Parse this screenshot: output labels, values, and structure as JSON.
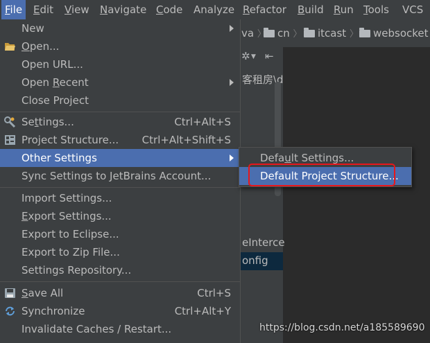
{
  "menubar": {
    "items": [
      {
        "mnemonic": "F",
        "rest": "ile"
      },
      {
        "mnemonic": "E",
        "rest": "dit"
      },
      {
        "mnemonic": "V",
        "rest": "iew"
      },
      {
        "mnemonic": "N",
        "rest": "avigate"
      },
      {
        "mnemonic": "C",
        "rest": "ode"
      },
      {
        "mnemonic": "",
        "rest": "Analyze"
      },
      {
        "mnemonic": "R",
        "rest": "efactor"
      },
      {
        "mnemonic": "B",
        "rest": "uild"
      },
      {
        "mnemonic": "R",
        "rest": "un"
      },
      {
        "mnemonic": "T",
        "rest": "ools"
      },
      {
        "mnemonic": "",
        "rest": "VCS"
      }
    ]
  },
  "breadcrumb": {
    "partial": "va",
    "items": [
      "cn",
      "itcast",
      "websocket"
    ]
  },
  "project_panel": {
    "tool_gear": "✲",
    "tool_collapse": "⇤",
    "text_top": "客租房\\d",
    "text_intercept": "eInterce",
    "text_config": "onfig"
  },
  "file_menu": {
    "new": "New",
    "open": {
      "pre": "",
      "m": "O",
      "post": "pen..."
    },
    "open_url": "Open URL...",
    "open_recent": {
      "pre": "Open ",
      "m": "R",
      "post": "ecent"
    },
    "close_project": "Close Project",
    "settings": {
      "pre": "Se",
      "m": "t",
      "post": "tings..."
    },
    "settings_shortcut": "Ctrl+Alt+S",
    "project_structure": "Project Structure...",
    "project_structure_shortcut": "Ctrl+Alt+Shift+S",
    "other_settings": "Other Settings",
    "sync_settings": "Sync Settings to JetBrains Account...",
    "import_settings": "Import Settings...",
    "export_settings": {
      "pre": "",
      "m": "E",
      "post": "xport Settings..."
    },
    "export_eclipse": "Export to Eclipse...",
    "export_zip": "Export to Zip File...",
    "settings_repo": "Settings Repository...",
    "save_all": {
      "pre": "",
      "m": "S",
      "post": "ave All"
    },
    "save_all_shortcut": "Ctrl+S",
    "synchronize": "Synchronize",
    "synchronize_shortcut": "Ctrl+Alt+Y",
    "invalidate": "Invalidate Caches / Restart..."
  },
  "submenu": {
    "default_settings": {
      "pre": "Defa",
      "m": "u",
      "post": "lt Settings..."
    },
    "default_project_structure": "Default Project Structure..."
  },
  "colors": {
    "highlight": "#4b6eaf",
    "menu_bg": "#3c3f41",
    "annotation": "#e8161b"
  },
  "watermark": "https://blog.csdn.net/a185589690"
}
